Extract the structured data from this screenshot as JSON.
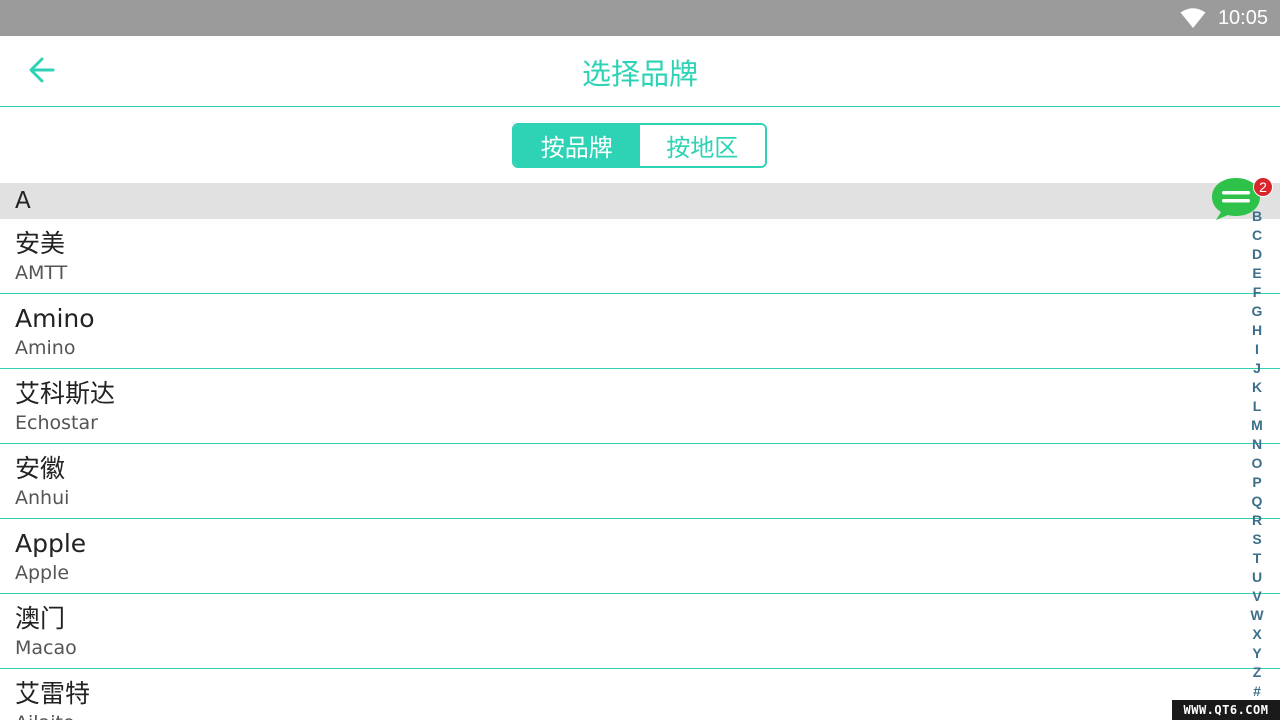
{
  "status_bar": {
    "time": "10:05",
    "wifi_icon": "wifi-icon"
  },
  "header": {
    "back_icon": "arrow-left-icon",
    "title": "选择品牌"
  },
  "tabs": [
    {
      "label": "按品牌",
      "active": true
    },
    {
      "label": "按地区",
      "active": false
    }
  ],
  "section": {
    "letter": "A"
  },
  "brands": [
    {
      "name": "安美",
      "sub": "AMTT"
    },
    {
      "name": "Amino",
      "sub": "Amino"
    },
    {
      "name": "艾科斯达",
      "sub": "Echostar"
    },
    {
      "name": "安徽",
      "sub": "Anhui"
    },
    {
      "name": "Apple",
      "sub": "Apple"
    },
    {
      "name": "澳门",
      "sub": "Macao"
    },
    {
      "name": "艾雷特",
      "sub": "Ailaite"
    }
  ],
  "alphabet": [
    "B",
    "C",
    "D",
    "E",
    "F",
    "G",
    "H",
    "I",
    "J",
    "K",
    "L",
    "M",
    "N",
    "O",
    "P",
    "Q",
    "R",
    "S",
    "T",
    "U",
    "V",
    "W",
    "X",
    "Y",
    "Z",
    "#"
  ],
  "chat": {
    "icon": "chat-bubble-icon",
    "badge": "2"
  },
  "watermark": "WWW.QT6.COM",
  "colors": {
    "accent": "#2dd3b4",
    "status_bar": "#9b9b9b",
    "section_bg": "#e1e1e1",
    "index_text": "#3e6f8a",
    "fab": "#2ec24b",
    "badge": "#d8262c"
  }
}
